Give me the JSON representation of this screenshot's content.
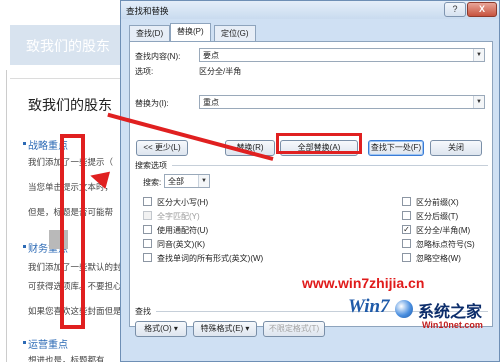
{
  "document": {
    "banner": "致我们的股东",
    "title": "致我们的股东",
    "sections": [
      {
        "heading": "战略重点"
      },
      {
        "heading": "财务重点"
      },
      {
        "heading": "运营重点"
      }
    ],
    "paragraphs": [
      "我们添加了一些提示（",
      "当您单击提示文本时，",
      "但是，标题是否可能帮",
      "我们添加了一些默认的封面。",
      "可获得选项库。不要担心",
      "如果您喜欢这些封面但是",
      "想进也是，标题都有"
    ]
  },
  "dialog": {
    "title": "查找和替换",
    "help_glyph": "?",
    "close_glyph": "X",
    "tabs": [
      "查找(D)",
      "替换(P)",
      "定位(G)"
    ],
    "active_tab": "替换(P)",
    "find_label": "查找内容(N):",
    "find_value": "要点",
    "options_label": "选项:",
    "options_value": "区分全/半角",
    "replace_label": "替换为(I):",
    "replace_value": "重点",
    "buttons": {
      "less": "<< 更少(L)",
      "replace": "替换(R)",
      "replace_all": "全部替换(A)",
      "find_next": "查找下一处(F)",
      "close": "关闭"
    },
    "search_options_label": "搜索选项",
    "search_label": "搜索:",
    "search_value": "全部",
    "checkboxes_left": [
      {
        "label": "区分大小写(H)",
        "checked": false,
        "disabled": false
      },
      {
        "label": "全字匹配(Y)",
        "checked": false,
        "disabled": true
      },
      {
        "label": "使用通配符(U)",
        "checked": false,
        "disabled": false
      },
      {
        "label": "同音(英文)(K)",
        "checked": false,
        "disabled": false
      },
      {
        "label": "查找单词的所有形式(英文)(W)",
        "checked": false,
        "disabled": false
      }
    ],
    "checkboxes_right": [
      {
        "label": "区分前缀(X)",
        "checked": false,
        "disabled": false
      },
      {
        "label": "区分后缀(T)",
        "checked": false,
        "disabled": false
      },
      {
        "label": "区分全/半角(M)",
        "checked": true,
        "disabled": false
      },
      {
        "label": "忽略标点符号(S)",
        "checked": false,
        "disabled": false
      },
      {
        "label": "忽略空格(W)",
        "checked": false,
        "disabled": false
      }
    ],
    "replace_section_label": "查找",
    "bottom_buttons": {
      "format": "格式(O) ▾",
      "special": "特殊格式(E) ▾",
      "no_format": "不限定格式(T)"
    }
  },
  "watermark": {
    "url": "www.win7zhijia.cn",
    "logo_text": "Win7",
    "brand": "系统之家",
    "domain": "Win10net.com"
  },
  "colors": {
    "annotation_red": "#e02020",
    "dialog_bg": "#cfe0f3",
    "heading_blue": "#2c6ab5"
  }
}
